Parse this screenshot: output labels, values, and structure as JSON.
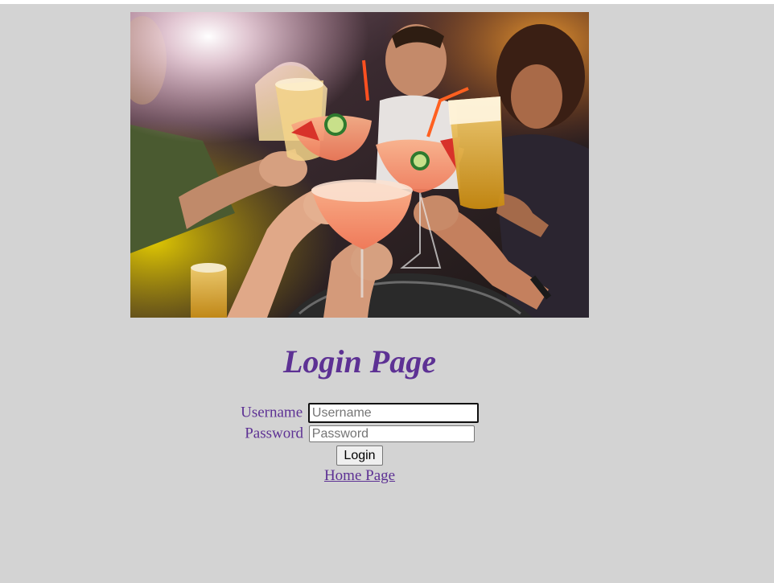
{
  "hero_image": {
    "alt": "Friends toasting cocktails and beer at a bar"
  },
  "page_title": "Login Page",
  "form": {
    "username_label": "Username",
    "username_placeholder": "Username",
    "username_value": "",
    "password_label": "Password",
    "password_placeholder": "Password",
    "password_value": "",
    "login_button": "Login"
  },
  "home_link": "Home Page",
  "colors": {
    "page_background": "#d3d3d3",
    "accent_purple": "#5d3194",
    "top_strip": "#ffffff"
  }
}
